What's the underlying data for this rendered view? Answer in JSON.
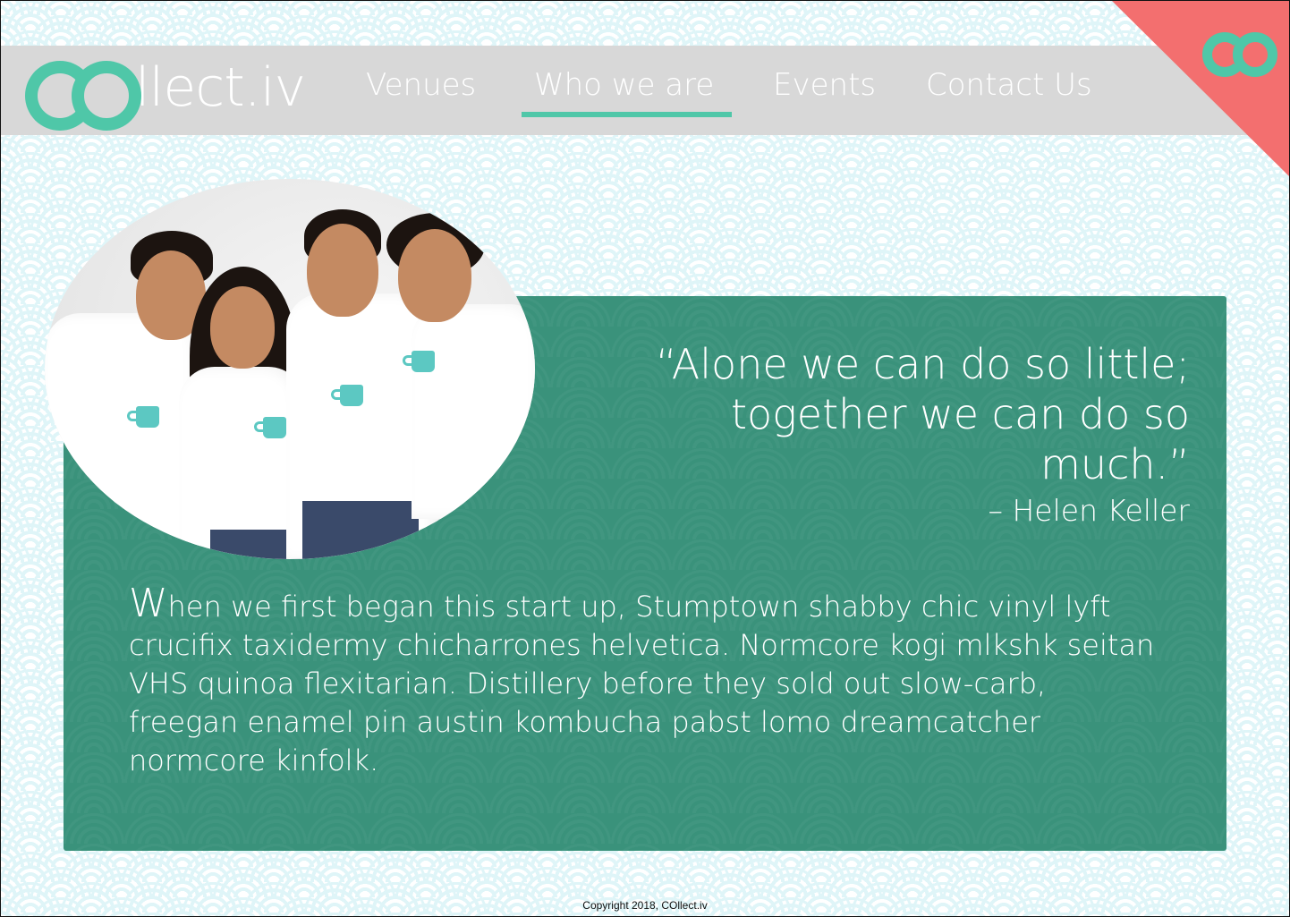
{
  "brand": {
    "logo_text": "llect.iv",
    "logo_letters": "CO",
    "name": "COllect.iv"
  },
  "nav": {
    "items": [
      {
        "label": "Venues",
        "active": false
      },
      {
        "label": "Who we are",
        "active": true
      },
      {
        "label": "Events",
        "active": false
      },
      {
        "label": "Contact Us",
        "active": false
      }
    ]
  },
  "quote": {
    "text": "“Alone we can do so little; together we can do so much.”",
    "author": "– Helen Keller"
  },
  "about": {
    "dropcap": "W",
    "text": "hen we first began this start up, Stumptown shabby chic vinyl lyft crucifix taxidermy chicharrones helvetica. Normcore kogi mlkshk seitan VHS quinoa flexitarian. Distillery before they sold out slow-carb, freegan enamel pin austin kombucha pabst lomo dreamcatcher normcore kinfolk."
  },
  "footer": {
    "copyright": "Copyright 2018, COllect.iv"
  },
  "colors": {
    "accent": "#4fc7a8",
    "card": "#3a927b",
    "corner": "#f36f6f",
    "nav": "#d8d8d8"
  }
}
